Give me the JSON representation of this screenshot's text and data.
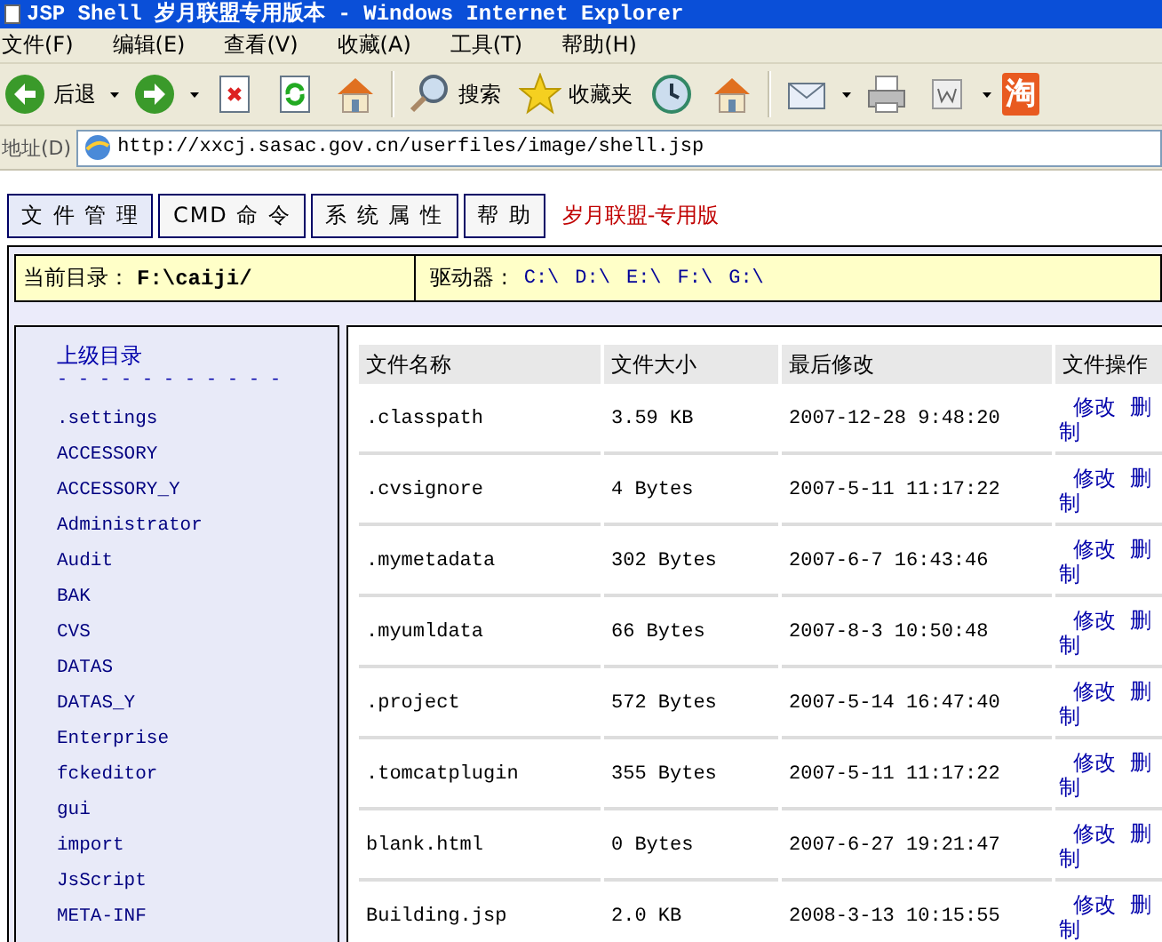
{
  "window": {
    "title": "JSP Shell 岁月联盟专用版本 - Windows Internet Explorer"
  },
  "menu": [
    "文件(F)",
    "编辑(E)",
    "查看(V)",
    "收藏(A)",
    "工具(T)",
    "帮助(H)"
  ],
  "toolbar": [
    {
      "kind": "back",
      "label": "后退",
      "dropdown": true
    },
    {
      "kind": "forward",
      "dropdown": true
    },
    {
      "kind": "stop",
      "dropdown": false
    },
    {
      "kind": "refresh",
      "dropdown": false
    },
    {
      "kind": "home",
      "dropdown": false
    },
    {
      "kind": "separator"
    },
    {
      "kind": "search",
      "label": "搜索",
      "dropdown": false
    },
    {
      "kind": "favorites",
      "label": "收藏夹",
      "dropdown": false
    },
    {
      "kind": "history",
      "dropdown": false
    },
    {
      "kind": "home",
      "dropdown": false
    },
    {
      "kind": "separator"
    },
    {
      "kind": "mail",
      "dropdown": true
    },
    {
      "kind": "print",
      "dropdown": false
    },
    {
      "kind": "word",
      "dropdown": true
    },
    {
      "kind": "taobao",
      "label": "淘",
      "dropdown": false
    }
  ],
  "address": {
    "label": "地址(D)",
    "url": "http://xxcj.sasac.gov.cn/userfiles/image/shell.jsp"
  },
  "tabs": [
    {
      "label": "文 件 管 理",
      "selected": true
    },
    {
      "label": "CMD 命 令",
      "selected": false
    },
    {
      "label": "系 统 属 性",
      "selected": false
    },
    {
      "label": "帮 助",
      "selected": false
    }
  ],
  "brand": "岁月联盟-专用版",
  "path_bar": {
    "label": "当前目录：",
    "path": "F:\\caiji/",
    "drives_label": "驱动器 :",
    "drives": [
      "C:\\",
      "D:\\",
      "E:\\",
      "F:\\",
      "G:\\"
    ]
  },
  "sidebar": {
    "parent": "上级目录",
    "separator": "- - - - - - - - - - -",
    "items": [
      ".settings",
      "ACCESSORY",
      "ACCESSORY_Y",
      "Administrator",
      "Audit",
      "BAK",
      "CVS",
      "DATAS",
      "DATAS_Y",
      "Enterprise",
      "fckeditor",
      "gui",
      "import",
      "JsScript",
      "META-INF"
    ]
  },
  "table": {
    "columns": [
      "文件名称",
      "文件大小",
      "最后修改",
      "文件操作"
    ],
    "rows": [
      {
        "name": ".classpath",
        "size": "3.59 KB",
        "modified": "2007-12-28 9:48:20",
        "actions": [
          "修改",
          "删",
          "制"
        ]
      },
      {
        "name": ".cvsignore",
        "size": "4 Bytes",
        "modified": "2007-5-11 11:17:22",
        "actions": [
          "修改",
          "删",
          "制"
        ]
      },
      {
        "name": ".mymetadata",
        "size": "302 Bytes",
        "modified": "2007-6-7 16:43:46",
        "actions": [
          "修改",
          "删",
          "制"
        ]
      },
      {
        "name": ".myumldata",
        "size": "66 Bytes",
        "modified": "2007-8-3 10:50:48",
        "actions": [
          "修改",
          "删",
          "制"
        ]
      },
      {
        "name": ".project",
        "size": "572 Bytes",
        "modified": "2007-5-14 16:47:40",
        "actions": [
          "修改",
          "删",
          "制"
        ]
      },
      {
        "name": ".tomcatplugin",
        "size": "355 Bytes",
        "modified": "2007-5-11 11:17:22",
        "actions": [
          "修改",
          "删",
          "制"
        ]
      },
      {
        "name": "blank.html",
        "size": "0 Bytes",
        "modified": "2007-6-27 19:21:47",
        "actions": [
          "修改",
          "删",
          "制"
        ]
      },
      {
        "name": "Building.jsp",
        "size": "2.0 KB",
        "modified": "2008-3-13 10:15:55",
        "actions": [
          "修改",
          "删",
          "制"
        ]
      }
    ]
  }
}
